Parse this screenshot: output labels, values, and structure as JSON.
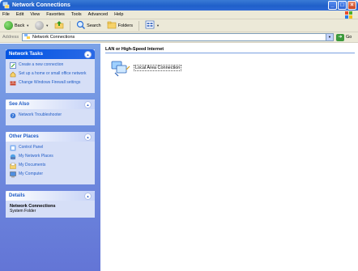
{
  "window": {
    "title": "Network Connections"
  },
  "menu": [
    "File",
    "Edit",
    "View",
    "Favorites",
    "Tools",
    "Advanced",
    "Help"
  ],
  "toolbar": {
    "back": "Back",
    "search": "Search",
    "folders": "Folders"
  },
  "address": {
    "label": "Address",
    "value": "Network Connections",
    "go": "Go"
  },
  "taskpane": {
    "network_tasks": {
      "title": "Network Tasks",
      "items": [
        "Create a new connection",
        "Set up a home or small office network",
        "Change Windows Firewall settings"
      ]
    },
    "see_also": {
      "title": "See Also",
      "items": [
        "Network Troubleshooter"
      ]
    },
    "other_places": {
      "title": "Other Places",
      "items": [
        "Control Panel",
        "My Network Places",
        "My Documents",
        "My Computer"
      ]
    },
    "details": {
      "title": "Details",
      "name": "Network Connections",
      "type": "System Folder"
    }
  },
  "content": {
    "group": "LAN or High-Speed Internet",
    "connection": "Local Area Connection"
  }
}
